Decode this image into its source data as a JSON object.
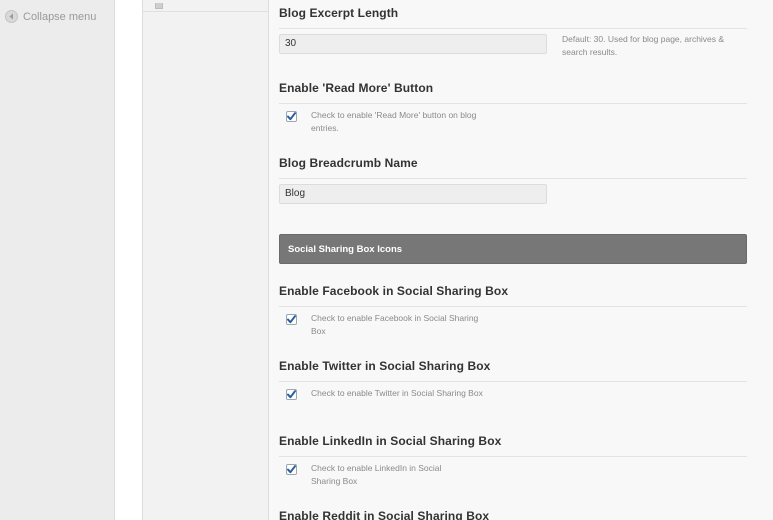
{
  "admin_menu": {
    "collapse_label": "Collapse menu"
  },
  "options": {
    "excerpt": {
      "heading": "Blog Excerpt Length",
      "value": "30",
      "description": "Default: 30. Used for blog page, archives & search results."
    },
    "read_more": {
      "heading": "Enable 'Read More' Button",
      "checked": true,
      "description": "Check to enable 'Read More' button on blog entries."
    },
    "breadcrumb": {
      "heading": "Blog Breadcrumb Name",
      "value": "Blog"
    },
    "group_title": "Social Sharing Box Icons",
    "facebook": {
      "heading": "Enable Facebook in Social Sharing Box",
      "checked": true,
      "description": "Check to enable Facebook in Social Sharing Box"
    },
    "twitter": {
      "heading": "Enable Twitter in Social Sharing Box",
      "checked": true,
      "description": "Check to enable Twitter in Social Sharing Box"
    },
    "linkedin": {
      "heading": "Enable LinkedIn in Social Sharing Box",
      "checked": true,
      "description": "Check to enable LinkedIn in Social Sharing Box"
    },
    "reddit": {
      "heading": "Enable Reddit in Social Sharing Box"
    }
  },
  "colors": {
    "accent_check": "#2d5d9b",
    "group_bar": "#777777"
  }
}
